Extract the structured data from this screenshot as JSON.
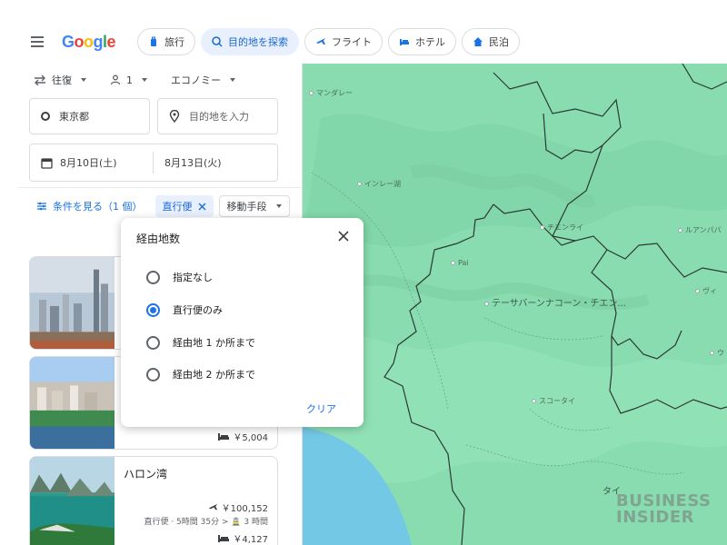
{
  "header": {
    "logo": "Google",
    "chips": [
      {
        "label": "旅行",
        "icon": "suitcase-icon",
        "active": false
      },
      {
        "label": "目的地を探索",
        "icon": "explore-icon",
        "active": true
      },
      {
        "label": "フライト",
        "icon": "airplane-icon",
        "active": false
      },
      {
        "label": "ホテル",
        "icon": "bed-icon",
        "active": false
      },
      {
        "label": "民泊",
        "icon": "house-icon",
        "active": false
      }
    ]
  },
  "search": {
    "trip_type": "往復",
    "passengers": "1",
    "cabin_class": "エコノミー",
    "origin": "東京都",
    "destination_placeholder": "目的地を入力",
    "depart_date": "8月10日(土)",
    "return_date": "8月13日(火)"
  },
  "filters": {
    "show_filters": "条件を見る（1 個）",
    "nonstop_chip": "直行便",
    "transport_chip": "移動手段"
  },
  "stops_popup": {
    "title": "経由地数",
    "options": [
      {
        "label": "指定なし",
        "checked": false
      },
      {
        "label": "直行便のみ",
        "checked": true
      },
      {
        "label": "経由地 1 か所まで",
        "checked": false
      },
      {
        "label": "経由地 2 か所まで",
        "checked": false
      }
    ],
    "clear": "クリア"
  },
  "cards": [
    {
      "title": "",
      "hotel_price": ""
    },
    {
      "title": "",
      "hotel_price": "￥5,004"
    },
    {
      "title": "ハロン湾",
      "flight_price": "￥100,152",
      "flight_detail": "直行便 · 5時間 35分 > 🚊 3 時間",
      "hotel_price": "￥4,127"
    }
  ],
  "map": {
    "labels": [
      {
        "text": "マンダレー"
      },
      {
        "text": "インレー湖"
      },
      {
        "text": "チエンライ"
      },
      {
        "text": "ルアンパバ"
      },
      {
        "text": "Pai"
      },
      {
        "text": "テーサバーンナコーン・チエン..."
      },
      {
        "text": "ヴィ"
      },
      {
        "text": "ウ"
      },
      {
        "text": "スコータイ"
      },
      {
        "text": "タイ"
      }
    ]
  },
  "watermark": {
    "line1": "BUSINESS",
    "line2": "INSIDER"
  },
  "colors": {
    "accent": "#1a73e8",
    "map_land": "#88dcb0",
    "map_water": "#73c8e6"
  }
}
